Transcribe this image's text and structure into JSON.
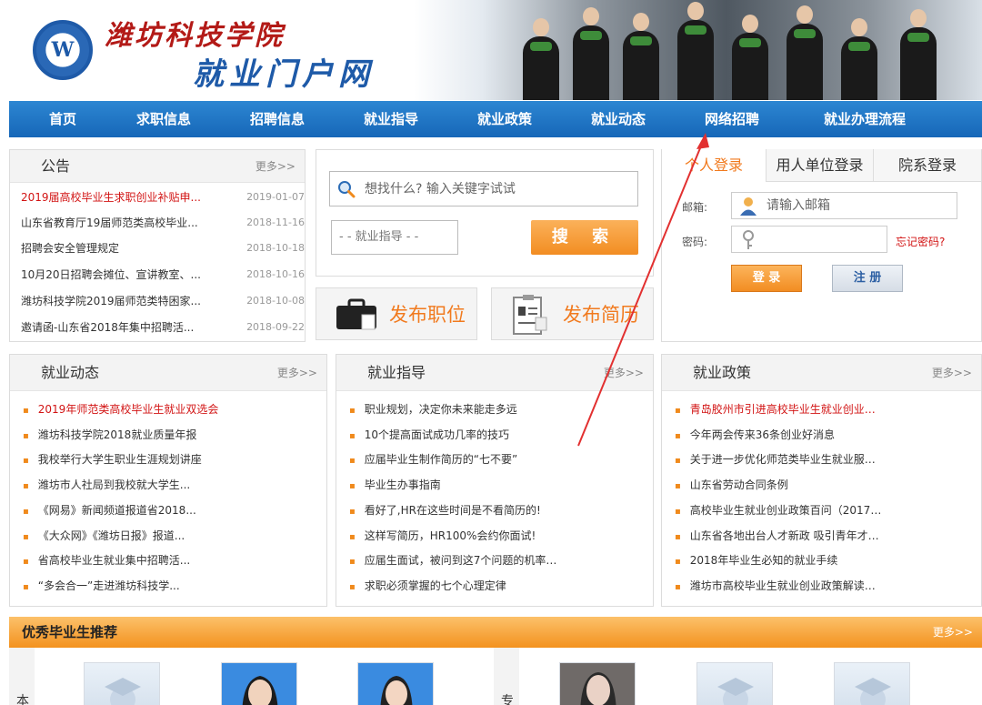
{
  "header": {
    "school_name": "潍坊科技学院",
    "portal_name": "就业门户网",
    "logo_letter": "W"
  },
  "nav": [
    "首页",
    "求职信息",
    "招聘信息",
    "就业指导",
    "就业政策",
    "就业动态",
    "网络招聘",
    "就业办理流程"
  ],
  "notice": {
    "title": "公告",
    "more": "更多>>",
    "items": [
      {
        "title": "2019届高校毕业生求职创业补贴申...",
        "date": "2019-01-07"
      },
      {
        "title": "山东省教育厅19届师范类高校毕业...",
        "date": "2018-11-16"
      },
      {
        "title": "招聘会安全管理规定",
        "date": "2018-10-18"
      },
      {
        "title": "10月20日招聘会摊位、宣讲教室、...",
        "date": "2018-10-16"
      },
      {
        "title": "潍坊科技学院2019届师范类特困家...",
        "date": "2018-10-08"
      },
      {
        "title": "邀请函-山东省2018年集中招聘活...",
        "date": "2018-09-22"
      }
    ]
  },
  "search": {
    "placeholder": "想找什么? 输入关键字试试",
    "category": "- - 就业指导 - -",
    "button": "搜 索"
  },
  "actions": {
    "post_job": "发布职位",
    "post_resume": "发布简历"
  },
  "login": {
    "tabs": [
      "个人登录",
      "用人单位登录",
      "院系登录"
    ],
    "email_label": "邮箱:",
    "email_placeholder": "请输入邮箱",
    "password_label": "密码:",
    "forgot": "忘记密码?",
    "login_button": "登 录",
    "register_button": "注 册"
  },
  "employment_news": {
    "title": "就业动态",
    "more": "更多>>",
    "items": [
      "2019年师范类高校毕业生就业双选会",
      "潍坊科技学院2018就业质量年报",
      "我校举行大学生职业生涯规划讲座",
      "潍坊市人社局到我校就大学生...",
      "《网易》新闻频道报道省2018...",
      "《大众网》《潍坊日报》报道...",
      "省高校毕业生就业集中招聘活...",
      "“多会合一”走进潍坊科技学..."
    ]
  },
  "employment_guidance": {
    "title": "就业指导",
    "more": "更多>>",
    "items": [
      "职业规划，决定你未来能走多远",
      "10个提高面试成功几率的技巧",
      "应届毕业生制作简历的“七不要”",
      "毕业生办事指南",
      "看好了,HR在这些时间是不看简历的!",
      "这样写简历，HR100%会约你面试!",
      "应届生面试，被问到这7个问题的机率…",
      "求职必须掌握的七个心理定律"
    ]
  },
  "employment_policy": {
    "title": "就业政策",
    "more": "更多>>",
    "items": [
      "青岛胶州市引进高校毕业生就业创业…",
      "今年两会传来36条创业好消息",
      "关于进一步优化师范类毕业生就业服…",
      "山东省劳动合同条例",
      "高校毕业生就业创业政策百问（2017…",
      "山东省各地出台人才新政 吸引青年才…",
      "2018年毕业生必知的就业手续",
      "潍坊市高校毕业生就业创业政策解读…"
    ]
  },
  "featured": {
    "title": "优秀毕业生推荐",
    "more": "更多>>",
    "side_left": "本",
    "side_right": "专"
  },
  "colors": {
    "nav_blue": "#1f76c8",
    "accent_orange": "#f17a1e",
    "link_red": "#d21414",
    "annotation_arrow": "#e23030"
  }
}
